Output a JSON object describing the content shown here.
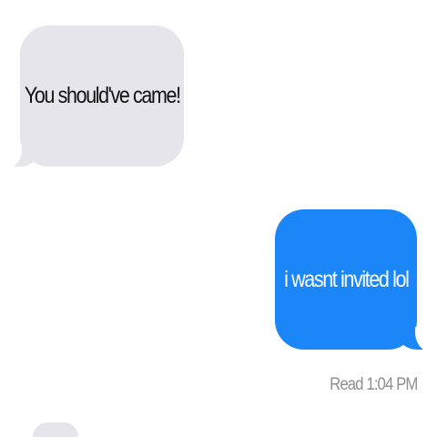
{
  "conversation": {
    "messages": [
      {
        "direction": "incoming",
        "text": "You should've came!"
      },
      {
        "direction": "outgoing",
        "text": "i wasnt invited lol"
      }
    ],
    "read_receipt": "Read 1:04 PM"
  },
  "colors": {
    "incoming_bubble": "#e6e5eb",
    "outgoing_bubble": "#1a86f8",
    "receipt_text": "#8e8e93"
  }
}
